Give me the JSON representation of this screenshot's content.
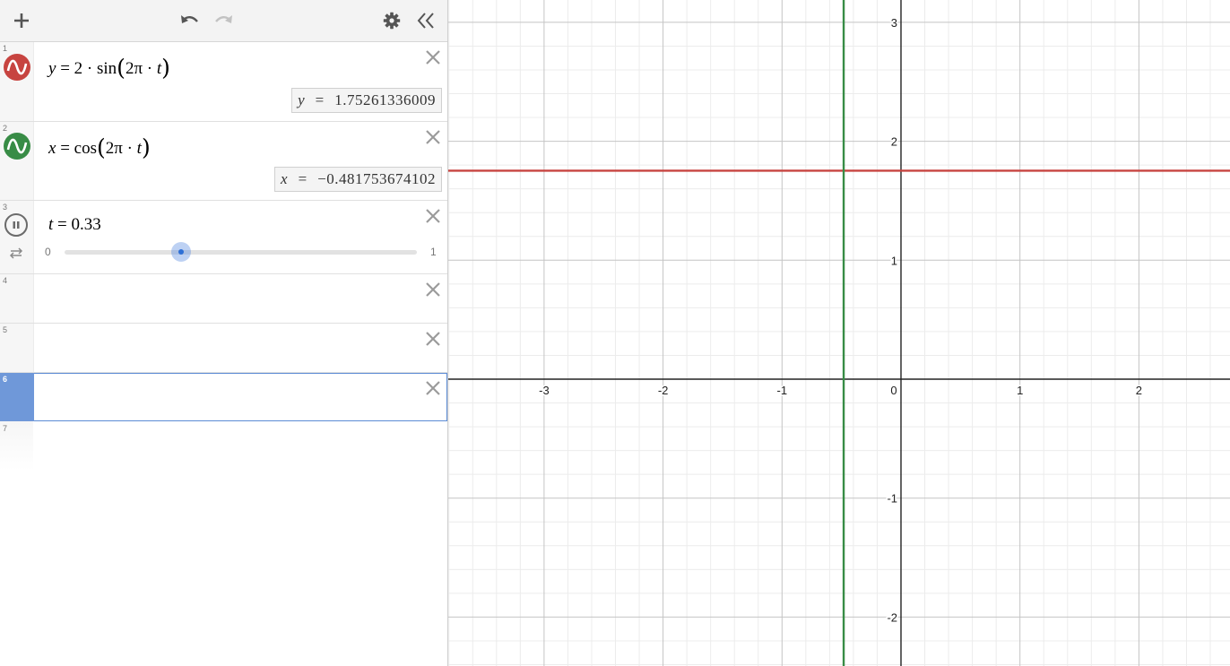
{
  "toolbar": {
    "add_icon": "plus-icon",
    "undo_icon": "undo-icon",
    "redo_icon": "redo-icon",
    "settings_icon": "gear-icon",
    "collapse_icon": "double-chevron-left-icon"
  },
  "expressions": [
    {
      "num": "1",
      "color": "#c74440",
      "lhs": "y",
      "eq": "=",
      "coef": "2",
      "dot": "·",
      "func": "sin",
      "inner_a": "2π",
      "inner_b": "t",
      "eval_var": "y",
      "eval_eq": "=",
      "eval_value": "1.75261336009"
    },
    {
      "num": "2",
      "color": "#388c46",
      "lhs": "x",
      "eq": "=",
      "func": "cos",
      "inner_a": "2π",
      "dot": "·",
      "inner_b": "t",
      "eval_var": "x",
      "eval_eq": "=",
      "eval_value": "−0.481753674102"
    },
    {
      "num": "3",
      "var": "t",
      "eq": "=",
      "value": "0.33",
      "slider_min": "0",
      "slider_max": "1",
      "slider_position": 0.33
    },
    {
      "num": "4"
    },
    {
      "num": "5"
    },
    {
      "num": "6"
    },
    {
      "num": "7"
    }
  ],
  "graph": {
    "x_ticks": [
      "-3",
      "-2",
      "-1",
      "0",
      "1",
      "2"
    ],
    "y_ticks": [
      "3",
      "2",
      "1",
      "-1",
      "-2"
    ],
    "horizontal_line": {
      "y": 1.75261336009,
      "color": "#c74440"
    },
    "vertical_line": {
      "x": -0.481753674102,
      "color": "#388c46"
    },
    "grid": true
  }
}
